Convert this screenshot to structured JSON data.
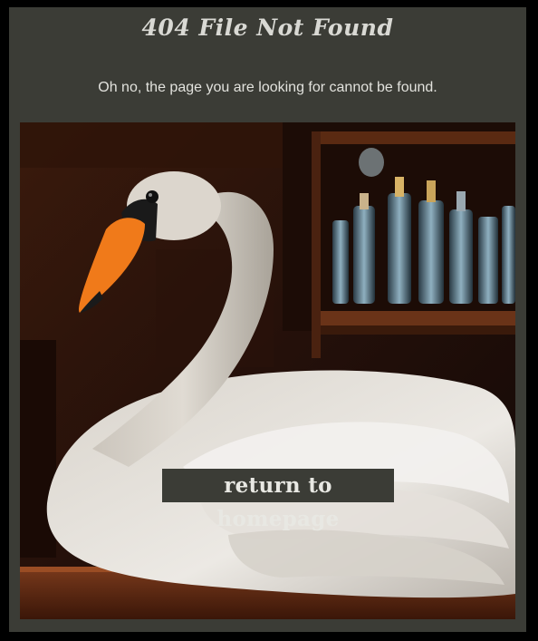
{
  "page": {
    "title": "404 File Not Found",
    "message": "Oh no, the page you are looking for cannot be found."
  },
  "hero_image": {
    "subject": "swan-on-bar-counter"
  },
  "home_link": {
    "label": "return to homepage"
  },
  "colors": {
    "page_background": "#000000",
    "panel_background": "#3b3c36",
    "text": "#e2e2dd"
  }
}
